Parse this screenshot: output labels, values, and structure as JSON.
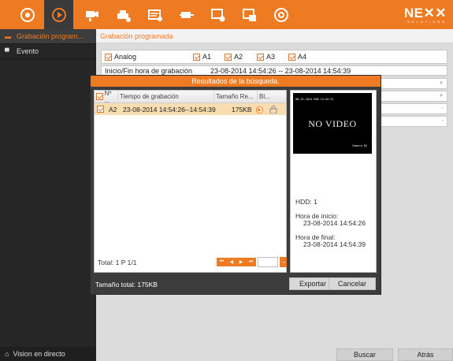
{
  "topbar": {
    "logo_main": "NE✕✕",
    "logo_sub": "SOLUTIONS",
    "icons": [
      "live-view-icon",
      "playback-icon",
      "camera-settings-icon",
      "record-icon",
      "alarm-icon",
      "network-icon",
      "device-icon",
      "system-icon",
      "power-icon"
    ]
  },
  "sidebar": {
    "items": [
      {
        "label": "Grabación program...",
        "active": true
      },
      {
        "label": "Evento",
        "active": false
      }
    ],
    "live_label": "Vision en directo"
  },
  "main": {
    "header": "Grabación programada",
    "checkboxes": [
      "Analog",
      "A1",
      "A2",
      "A3",
      "A4"
    ],
    "start_end_label": "Inicio/Fin hora de grabación",
    "start_end_value": "23-08-2014 14:54:26  --  23-08-2014 14:54:39",
    "buttons": {
      "search": "Buscar",
      "back": "Atrás"
    }
  },
  "dialog": {
    "title": "Resultados de la búsqueda.",
    "columns": [
      "Nº ...",
      "Tiempo de grabación",
      "Tamaño Re...",
      "Bl..."
    ],
    "rows": [
      {
        "no": "A2",
        "time": "23-08-2014 14:54:26--14:54:39",
        "size": "175KB"
      }
    ],
    "footer_total": "Total: 1  P 1/1",
    "preview": {
      "osd_time": "08-23-2014 SUN 14:54:21",
      "no_video": "NO VIDEO",
      "osd_camera": "Camera 02"
    },
    "hdd": "HDD: 1",
    "start_label": "Hora de inicio:",
    "start_value": "23-08-2014 14:54:26",
    "end_label": "Hora de final:",
    "end_value": "23-08-2014 14:54:39",
    "total_size": "Tamaño total: 175KB",
    "export_label": "Exportar",
    "cancel_label": "Cancelar"
  },
  "colors": {
    "accent": "#ee7a22",
    "sidebar": "#262626",
    "selected_row": "#f7ddb0"
  }
}
